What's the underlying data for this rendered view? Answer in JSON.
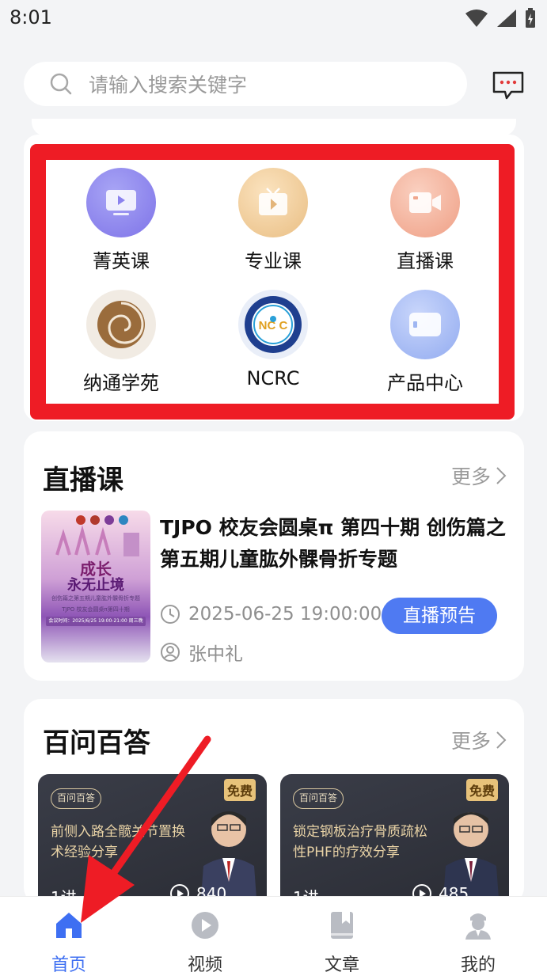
{
  "status": {
    "time": "8:01"
  },
  "search": {
    "placeholder": "请输入搜索关键字"
  },
  "quick_entries": [
    {
      "label": "菁英课",
      "icon": "elite-course-icon"
    },
    {
      "label": "专业课",
      "icon": "pro-course-icon"
    },
    {
      "label": "直播课",
      "icon": "live-course-icon"
    },
    {
      "label": "纳通学苑",
      "icon": "natong-academy-icon"
    },
    {
      "label": "NCRC",
      "icon": "ncrc-logo-icon"
    },
    {
      "label": "产品中心",
      "icon": "product-center-icon"
    }
  ],
  "live_section": {
    "title": "直播课",
    "more": "更多",
    "item": {
      "title": "TJPO 校友会圆桌π 第四十期 创伤篇之第五期儿童肱外髁骨折专题",
      "time": "2025-06-25 19:00:00",
      "speaker": "张中礼",
      "button": "直播预告",
      "poster_line1": "成长",
      "poster_line2": "永无止境",
      "poster_line3": "创伤篇之第五期儿童肱外髁骨折专题",
      "poster_line4": "TJPO 校友会圆桌π第四十期",
      "poster_line5": "会议时间：2025/6/25 19:00-21:00 周三晚"
    }
  },
  "qa_section": {
    "title": "百问百答",
    "more": "更多",
    "items": [
      {
        "tag": "百问百答",
        "free": "免费",
        "text": "前侧入路全髋关节置换术经验分享",
        "lectures": "1讲",
        "plays": "840"
      },
      {
        "tag": "百问百答",
        "free": "免费",
        "text": "锁定钢板治疗骨质疏松性PHF的疗效分享",
        "lectures": "1讲",
        "plays": "485"
      }
    ]
  },
  "nav": [
    {
      "label": "首页",
      "icon": "home-icon",
      "active": true
    },
    {
      "label": "视频",
      "icon": "video-icon",
      "active": false
    },
    {
      "label": "文章",
      "icon": "article-icon",
      "active": false
    },
    {
      "label": "我的",
      "icon": "profile-icon",
      "active": false
    }
  ],
  "colors": {
    "accent": "#3e6ff2",
    "highlight_frame": "#ee1c25",
    "button": "#4f7af2"
  }
}
